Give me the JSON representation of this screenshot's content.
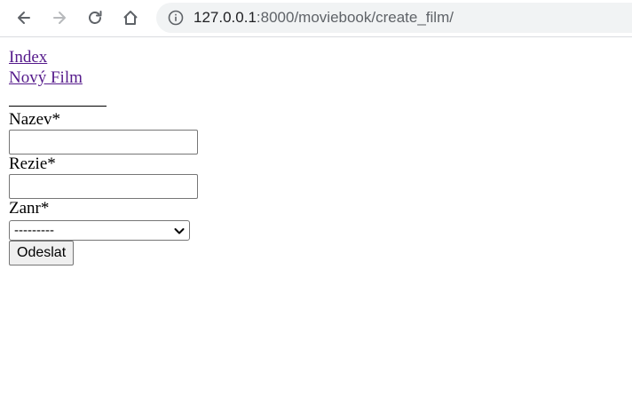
{
  "browser": {
    "url_host": "127.0.0.1",
    "url_rest": ":8000/moviebook/create_film/",
    "icons": {
      "back": "arrow-left-icon",
      "forward": "arrow-right-icon",
      "reload": "reload-icon",
      "home": "home-icon",
      "info": "info-icon"
    }
  },
  "nav": {
    "links": [
      "Index",
      "Nový Film"
    ]
  },
  "form": {
    "fields": [
      {
        "label": "Nazev*",
        "value": ""
      },
      {
        "label": "Rezie*",
        "value": ""
      },
      {
        "label": "Zanr*",
        "selected": "---------"
      }
    ],
    "submit_label": "Odeslat"
  },
  "colors": {
    "link": "#551a8b",
    "toolbar_icon": "#5f6368",
    "omnibox_bg": "#f1f3f4"
  }
}
